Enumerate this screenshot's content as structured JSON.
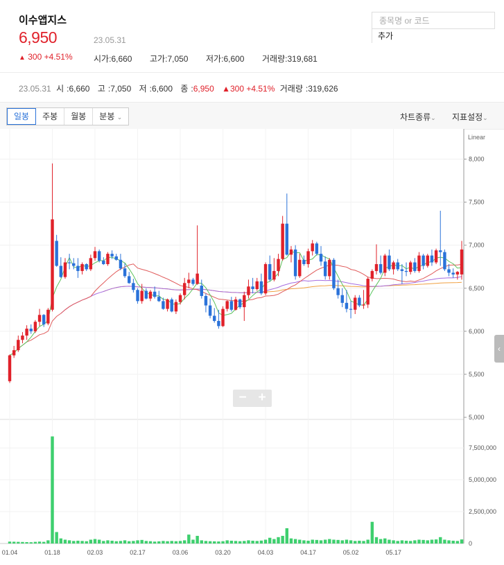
{
  "stock": {
    "name": "이수앱지스",
    "price": "6,950",
    "date": "23.05.31",
    "change_arrow": "▲",
    "change_text": "300 +4.51%"
  },
  "meta": {
    "open_label": "시가",
    "open": "6,660",
    "high_label": "고가",
    "high": "7,050",
    "low_label": "저가",
    "low": "6,600",
    "volume_label": "거래량",
    "volume": "319,681"
  },
  "search": {
    "placeholder": "종목명 or 코드",
    "add_label": "추가"
  },
  "summary": {
    "date": "23.05.31",
    "open_label": "시",
    "open": "6,660",
    "high_label": "고",
    "high": "7,050",
    "low_label": "저",
    "low": "6,600",
    "close_label": "종",
    "close": "6,950",
    "change": "▲300 +4.51%",
    "volume_label": "거래량",
    "volume": "319,626"
  },
  "toolbar": {
    "tabs": [
      "일봉",
      "주봉",
      "월봉",
      "분봉"
    ],
    "active_tab": "일봉",
    "chart_type_label": "차트종류",
    "indicator_label": "지표설정"
  },
  "zoom": {
    "minus": "−",
    "plus": "+"
  },
  "colors": {
    "up": "#e0212a",
    "down": "#2a72d9",
    "volume": "#3ecf6e",
    "ma5": "#5cc25c",
    "ma20": "#e05a5a",
    "ma60": "#a66ce0",
    "ma120": "#f0a040"
  },
  "chart_data": {
    "type": "candlestick",
    "scale_label": "Linear",
    "price_ticks": [
      5000,
      5500,
      6000,
      6500,
      7000,
      7500,
      8000
    ],
    "price_tick_labels": [
      "5,000",
      "5,500",
      "6,000",
      "6,500",
      "7,000",
      "7,500",
      "8,000"
    ],
    "ylim": [
      5000,
      8270
    ],
    "volume_ticks": [
      0,
      2500000,
      5000000,
      7500000
    ],
    "volume_tick_labels": [
      "0",
      "2,500,000",
      "5,000,000",
      "7,500,000"
    ],
    "volume_ylim": [
      0,
      8700000
    ],
    "x_labels": [
      "01.04",
      "01.18",
      "02.03",
      "02.17",
      "03.06",
      "03.20",
      "04.03",
      "04.17",
      "05.02",
      "05.17"
    ],
    "x_label_index": [
      0,
      10,
      20,
      30,
      40,
      50,
      60,
      70,
      80,
      90
    ],
    "series_meta": "day index, open, high, low, close, volume",
    "candles": [
      [
        5420,
        5730,
        5400,
        5720,
        150000
      ],
      [
        5720,
        5830,
        5690,
        5780,
        140000
      ],
      [
        5780,
        5950,
        5760,
        5900,
        130000
      ],
      [
        5900,
        5990,
        5860,
        5950,
        120000
      ],
      [
        5950,
        6070,
        5900,
        6030,
        110000
      ],
      [
        6030,
        6080,
        5970,
        6000,
        100000
      ],
      [
        6000,
        6130,
        5980,
        6110,
        130000
      ],
      [
        6110,
        6260,
        6060,
        6190,
        150000
      ],
      [
        6190,
        6200,
        6050,
        6080,
        130000
      ],
      [
        6090,
        6270,
        6070,
        6250,
        250000
      ],
      [
        6250,
        7950,
        6230,
        7300,
        8400000
      ],
      [
        7050,
        7120,
        6750,
        6760,
        900000
      ],
      [
        6760,
        6860,
        6620,
        6630,
        400000
      ],
      [
        6630,
        6850,
        6610,
        6800,
        300000
      ],
      [
        6800,
        6900,
        6720,
        6790,
        250000
      ],
      [
        6790,
        6850,
        6720,
        6760,
        200000
      ],
      [
        6760,
        6850,
        6620,
        6700,
        220000
      ],
      [
        6700,
        6800,
        6660,
        6780,
        200000
      ],
      [
        6780,
        6790,
        6700,
        6720,
        180000
      ],
      [
        6720,
        6890,
        6700,
        6850,
        300000
      ],
      [
        6850,
        6980,
        6820,
        6930,
        350000
      ],
      [
        6930,
        6950,
        6800,
        6820,
        300000
      ],
      [
        6820,
        6860,
        6770,
        6780,
        200000
      ],
      [
        6780,
        6920,
        6760,
        6900,
        250000
      ],
      [
        6900,
        6940,
        6840,
        6870,
        220000
      ],
      [
        6870,
        6900,
        6820,
        6830,
        180000
      ],
      [
        6830,
        6900,
        6710,
        6730,
        200000
      ],
      [
        6730,
        6790,
        6620,
        6640,
        250000
      ],
      [
        6640,
        6690,
        6550,
        6560,
        180000
      ],
      [
        6560,
        6610,
        6450,
        6480,
        200000
      ],
      [
        6480,
        6500,
        6320,
        6350,
        250000
      ],
      [
        6350,
        6550,
        6320,
        6470,
        280000
      ],
      [
        6470,
        6500,
        6370,
        6380,
        200000
      ],
      [
        6380,
        6480,
        6350,
        6460,
        180000
      ],
      [
        6460,
        6520,
        6380,
        6400,
        150000
      ],
      [
        6400,
        6470,
        6340,
        6350,
        170000
      ],
      [
        6350,
        6390,
        6250,
        6260,
        200000
      ],
      [
        6260,
        6380,
        6230,
        6370,
        180000
      ],
      [
        6370,
        6390,
        6220,
        6230,
        200000
      ],
      [
        6230,
        6370,
        6200,
        6340,
        180000
      ],
      [
        6340,
        6440,
        6310,
        6420,
        200000
      ],
      [
        6420,
        6620,
        6370,
        6560,
        250000
      ],
      [
        6560,
        6680,
        6500,
        6600,
        700000
      ],
      [
        6600,
        6620,
        6530,
        6550,
        300000
      ],
      [
        6550,
        7230,
        6540,
        6670,
        600000
      ],
      [
        6530,
        6600,
        6380,
        6410,
        250000
      ],
      [
        6410,
        6440,
        6220,
        6300,
        200000
      ],
      [
        6300,
        6380,
        6150,
        6180,
        180000
      ],
      [
        6180,
        6270,
        6100,
        6120,
        170000
      ],
      [
        6120,
        6250,
        6030,
        6060,
        160000
      ],
      [
        6060,
        6290,
        6050,
        6260,
        180000
      ],
      [
        6260,
        6360,
        6230,
        6350,
        250000
      ],
      [
        6350,
        6400,
        6230,
        6250,
        220000
      ],
      [
        6250,
        6400,
        6240,
        6370,
        200000
      ],
      [
        6370,
        6380,
        6260,
        6280,
        180000
      ],
      [
        6280,
        6460,
        6120,
        6420,
        200000
      ],
      [
        6420,
        6600,
        6380,
        6520,
        250000
      ],
      [
        6520,
        6620,
        6440,
        6490,
        220000
      ],
      [
        6490,
        6620,
        6470,
        6580,
        200000
      ],
      [
        6580,
        6670,
        6420,
        6440,
        230000
      ],
      [
        6440,
        6800,
        6420,
        6780,
        300000
      ],
      [
        6780,
        6880,
        6580,
        6600,
        450000
      ],
      [
        6600,
        6850,
        6580,
        6700,
        350000
      ],
      [
        6700,
        6900,
        6640,
        6840,
        500000
      ],
      [
        6840,
        7340,
        6820,
        7250,
        600000
      ],
      [
        7250,
        7600,
        6880,
        6890,
        1200000
      ],
      [
        6890,
        6990,
        6800,
        6950,
        400000
      ],
      [
        6950,
        7000,
        6600,
        6640,
        350000
      ],
      [
        6640,
        6900,
        6620,
        6830,
        300000
      ],
      [
        6830,
        6880,
        6760,
        6780,
        250000
      ],
      [
        6780,
        6960,
        6740,
        6930,
        220000
      ],
      [
        6930,
        7060,
        6880,
        7020,
        300000
      ],
      [
        7020,
        7040,
        6880,
        6900,
        280000
      ],
      [
        6900,
        6990,
        6760,
        6810,
        250000
      ],
      [
        6810,
        6870,
        6600,
        6640,
        300000
      ],
      [
        6640,
        6850,
        6600,
        6830,
        350000
      ],
      [
        6830,
        6850,
        6480,
        6500,
        300000
      ],
      [
        6500,
        6600,
        6380,
        6420,
        280000
      ],
      [
        6420,
        6500,
        6280,
        6330,
        250000
      ],
      [
        6330,
        6480,
        6220,
        6260,
        300000
      ],
      [
        6260,
        6350,
        6150,
        6250,
        250000
      ],
      [
        6250,
        6420,
        6200,
        6390,
        200000
      ],
      [
        6390,
        6420,
        6280,
        6300,
        220000
      ],
      [
        6300,
        6480,
        6260,
        6310,
        200000
      ],
      [
        6310,
        6630,
        6270,
        6610,
        300000
      ],
      [
        6610,
        6720,
        6580,
        6700,
        1700000
      ],
      [
        6700,
        7010,
        6660,
        6780,
        500000
      ],
      [
        6780,
        6880,
        6660,
        6680,
        350000
      ],
      [
        6680,
        6900,
        6640,
        6880,
        400000
      ],
      [
        6880,
        6950,
        6700,
        6720,
        300000
      ],
      [
        6720,
        6820,
        6660,
        6800,
        250000
      ],
      [
        6800,
        6840,
        6700,
        6720,
        200000
      ],
      [
        6720,
        6780,
        6550,
        6700,
        250000
      ],
      [
        6700,
        6800,
        6640,
        6690,
        220000
      ],
      [
        6690,
        6820,
        6660,
        6800,
        200000
      ],
      [
        6800,
        6850,
        6680,
        6700,
        250000
      ],
      [
        6700,
        6920,
        6680,
        6880,
        300000
      ],
      [
        6880,
        6900,
        6720,
        6760,
        280000
      ],
      [
        6760,
        6900,
        6740,
        6880,
        250000
      ],
      [
        6880,
        6950,
        6760,
        6800,
        300000
      ],
      [
        6800,
        6960,
        6780,
        6940,
        320000
      ],
      [
        6940,
        7400,
        6760,
        6920,
        500000
      ],
      [
        6920,
        6950,
        6700,
        6720,
        300000
      ],
      [
        6720,
        6780,
        6640,
        6680,
        250000
      ],
      [
        6680,
        6730,
        6620,
        6660,
        220000
      ],
      [
        6660,
        6700,
        6600,
        6690,
        200000
      ],
      [
        6660,
        7050,
        6600,
        6950,
        319626
      ]
    ]
  }
}
